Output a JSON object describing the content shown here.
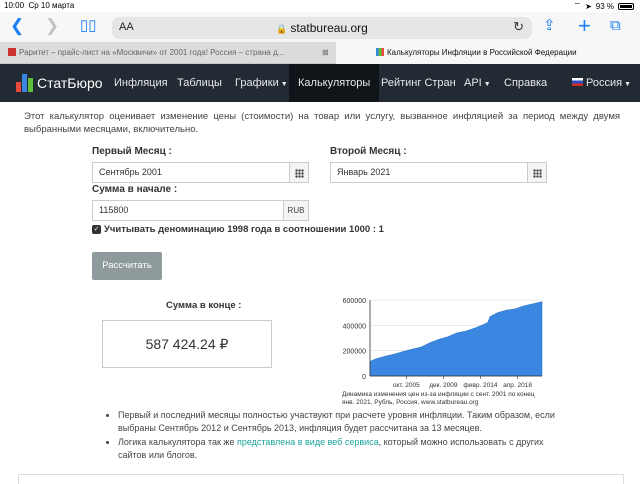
{
  "status_bar": {
    "time": "10:00",
    "date": "Ср 10 марта",
    "battery": "93 %"
  },
  "browser": {
    "aa_label": "AA",
    "url": "statbureau.org",
    "tabs": [
      {
        "title": "Раритет – прайс-лист на «Москвичи» от 2001 года! Россия – страна д..."
      },
      {
        "title": "Калькуляторы Инфляции в Российской Федерации"
      }
    ]
  },
  "nav": {
    "logo": "СтатБюро",
    "items": [
      {
        "label": "Инфляция"
      },
      {
        "label": "Таблицы"
      },
      {
        "label": "Графики"
      },
      {
        "label": "Калькуляторы"
      },
      {
        "label": "Рейтинг Стран"
      },
      {
        "label": "API"
      },
      {
        "label": "Справка"
      },
      {
        "label": "Россия"
      }
    ]
  },
  "calculator": {
    "description": "Этот калькулятор оценивает изменение цены (стоимости) на товар или услугу, вызванное инфляцией за период между двумя выбранными месяцами, включительно.",
    "first_month_label": "Первый Месяц :",
    "first_month_value": "Сентябрь 2001",
    "second_month_label": "Второй Месяц :",
    "second_month_value": "Январь 2021",
    "amount_label": "Сумма в начале :",
    "amount_value": "115800",
    "currency": "RUB",
    "denomination_label": "Учитывать деноминацию 1998 года в соотношении 1000 : 1",
    "denomination_checked": true,
    "calculate_button": "Рассчитать",
    "result_label": "Сумма в конце :",
    "result_value": "587 424.24 ₽"
  },
  "chart_caption": "Динамика изменения цен из-за инфляции с сент. 2001 по конец янв. 2021, Рубль, Россия, www.statbureau.org",
  "chart_data": {
    "type": "area",
    "x": [
      "2001-09",
      "2002-06",
      "2003-06",
      "2004-06",
      "2005-06",
      "2006-06",
      "2007-06",
      "2008-06",
      "2009-06",
      "2010-06",
      "2011-06",
      "2012-06",
      "2013-06",
      "2014-06",
      "2014-12",
      "2015-03",
      "2016-01",
      "2017-01",
      "2018-01",
      "2019-01",
      "2020-01",
      "2021-01"
    ],
    "values": [
      115800,
      138000,
      157000,
      173000,
      194000,
      212000,
      229000,
      263000,
      290000,
      310000,
      340000,
      354000,
      378000,
      406000,
      424000,
      470000,
      500000,
      520000,
      530000,
      555000,
      570000,
      587424
    ],
    "x_tick_labels": [
      "окт. 2005",
      "дек. 2009",
      "февр. 2014",
      "апр. 2018"
    ],
    "y_tick_labels": [
      "0",
      "200000",
      "400000",
      "600000"
    ],
    "ylim": [
      0,
      600000
    ],
    "color": "#3a86e0",
    "grid": true
  },
  "notes": {
    "bullet1": "Первый и последний месяцы полностью участвуют при расчете уровня инфляции. Таким образом, если выбраны Сентябрь 2012 и Сентябрь 2013, инфляция будет рассчитана за 13 месяцев.",
    "bullet2_prefix": "Логика калькулятора так же ",
    "bullet2_link": "представлена в виде веб сервиса",
    "bullet2_suffix": ", который можно использовать с других сайтов или блогов."
  },
  "colors": {
    "nav_bg": "#222b33",
    "nav_active": "#10151a",
    "accent_link": "#1ba39c",
    "button_bg": "#8e9a9c",
    "ios_blue": "#1a7ef5"
  }
}
